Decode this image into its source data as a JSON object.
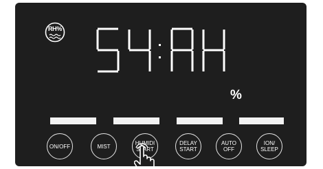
{
  "display": {
    "humidity_icon_label": "RH%",
    "segment_text": "54:AH",
    "unit": "%"
  },
  "bars": 4,
  "buttons": [
    {
      "id": "on-off",
      "label": "ON/OFF"
    },
    {
      "id": "mist",
      "label": "MIST"
    },
    {
      "id": "humidi-start",
      "label": "HUMIDI\nSTART"
    },
    {
      "id": "delay-start",
      "label": "DELAY\nSTART"
    },
    {
      "id": "auto-off",
      "label": "AUTO\nOFF"
    },
    {
      "id": "ion-sleep",
      "label": "ION/\nSLEEP"
    }
  ],
  "colors": {
    "panel": "#1e1e1e",
    "segments": "#ffffff",
    "button_border": "#e6e6e6"
  }
}
